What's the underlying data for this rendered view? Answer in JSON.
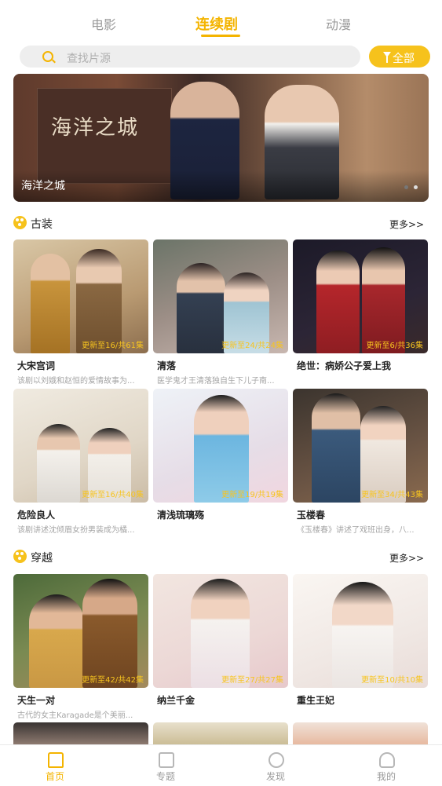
{
  "tabs": [
    "电影",
    "连续剧",
    "动漫"
  ],
  "search": {
    "placeholder": "查找片源"
  },
  "filter_button": {
    "label": "全部"
  },
  "banner": {
    "caption": "海洋之城",
    "poster_title": "海洋之城"
  },
  "sections": [
    {
      "title": "古装",
      "more": "更多>>",
      "cards": [
        {
          "title": "大宋宫词",
          "desc": "该剧以刘娥和赵恒的爱情故事为...",
          "ep": "更新至16/共61集"
        },
        {
          "title": "清落",
          "desc": "医学鬼才王清落独自生下儿子南...",
          "ep": "更新至24/共24集"
        },
        {
          "title": "绝世：病娇公子爱上我",
          "desc": "",
          "ep": "更新至6/共36集"
        },
        {
          "title": "危险良人",
          "desc": "该剧讲述沈倾眉女扮男装成为橘...",
          "ep": "更新至16/共40集"
        },
        {
          "title": "清浅琉璃殇",
          "desc": "",
          "ep": "更新至19/共19集"
        },
        {
          "title": "玉楼春",
          "desc": "《玉楼春》讲述了戏班出身，八...",
          "ep": "更新至34/共43集"
        }
      ]
    },
    {
      "title": "穿越",
      "more": "更多>>",
      "cards": [
        {
          "title": "天生一对",
          "desc": "古代的女主Karagade是个美丽...",
          "ep": "更新至42/共42集"
        },
        {
          "title": "纳兰千金",
          "desc": "",
          "ep": "更新至27/共27集"
        },
        {
          "title": "重生王妃",
          "desc": "",
          "ep": "更新至10/共10集"
        }
      ]
    }
  ],
  "bottom_nav": [
    "首页",
    "专题",
    "发现",
    "我的"
  ],
  "colors": {
    "accent": "#f4b400",
    "button": "#f6c21c"
  }
}
